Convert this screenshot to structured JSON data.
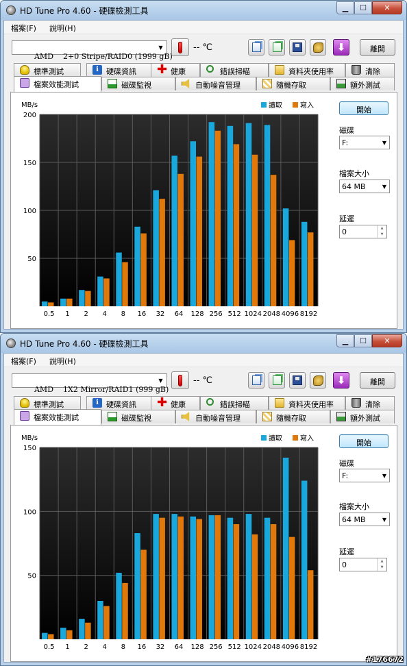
{
  "app": {
    "title": "HD Tune Pro 4.60 - 硬碟檢測工具",
    "menus": [
      "檔案(F)",
      "說明(H)"
    ],
    "temp": "-- ℃",
    "exit_label": "離開",
    "tabs_row1": [
      "標準測試",
      "硬碟資訊",
      "健康",
      "錯誤掃瞄",
      "資料夾使用率",
      "清除"
    ],
    "tabs_row2": [
      "檔案效能測試",
      "磁碟監視",
      "自動噪音管理",
      "隨機存取",
      "額外測試"
    ],
    "start_label": "開始",
    "disk_label": "磁碟",
    "disk_value": "F:",
    "filesize_label": "檔案大小",
    "filesize_value": "64 MB",
    "delay_label": "延遲",
    "delay_value": "0"
  },
  "colors": {
    "read": "#1aa7dc",
    "write": "#e0780c"
  },
  "windows": [
    {
      "drive": "AMD    2+0 Stripe/RAID0 (1999 gB)"
    },
    {
      "drive": "AMD    1X2 Mirror/RAID1 (999 gB)"
    }
  ],
  "chart_data": [
    {
      "type": "bar",
      "ylabel": "MB/s",
      "ylim": [
        0,
        200
      ],
      "yticks": [
        50,
        100,
        150,
        200
      ],
      "categories": [
        "0.5",
        "1",
        "2",
        "4",
        "8",
        "16",
        "32",
        "64",
        "128",
        "256",
        "512",
        "1024",
        "2048",
        "4096",
        "8192"
      ],
      "series": [
        {
          "name": "讀取",
          "values": [
            5,
            8,
            17,
            31,
            56,
            83,
            121,
            157,
            172,
            192,
            188,
            191,
            189,
            102,
            88
          ]
        },
        {
          "name": "寫入",
          "values": [
            4,
            8,
            16,
            29,
            46,
            76,
            112,
            138,
            156,
            183,
            169,
            158,
            137,
            69,
            77
          ]
        }
      ]
    },
    {
      "type": "bar",
      "ylabel": "MB/s",
      "ylim": [
        0,
        150
      ],
      "yticks": [
        50,
        100,
        150
      ],
      "categories": [
        "0.5",
        "1",
        "2",
        "4",
        "8",
        "16",
        "32",
        "64",
        "128",
        "256",
        "512",
        "1024",
        "2048",
        "4096",
        "8192"
      ],
      "series": [
        {
          "name": "讀取",
          "values": [
            5,
            9,
            16,
            30,
            52,
            83,
            98,
            98,
            96,
            97,
            95,
            98,
            95,
            142,
            124
          ]
        },
        {
          "name": "寫入",
          "values": [
            4,
            7,
            13,
            26,
            44,
            70,
            95,
            96,
            94,
            97,
            90,
            82,
            90,
            80,
            54
          ]
        }
      ]
    }
  ],
  "watermark": "#176672"
}
